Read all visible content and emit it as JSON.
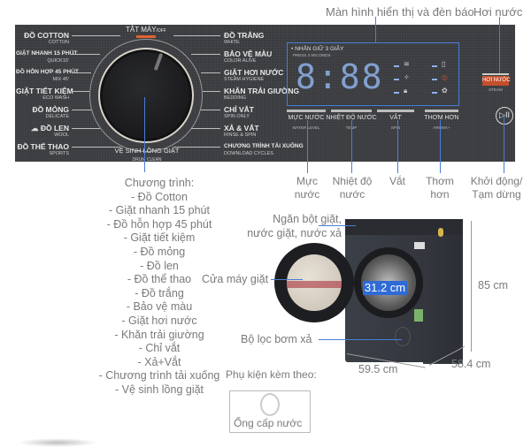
{
  "top_callouts": {
    "display": "Màn hình hiển thị và đèn báo",
    "steam": "Hơi nước"
  },
  "panel": {
    "off_label": "TẮT MÁY",
    "off_sub": "/OFF",
    "drum_clean": "VỆ SINH LỒNG GIẶT",
    "drum_clean_sub": "DRUM CLEAN",
    "left_programs": [
      {
        "label": "ĐỒ COTTON",
        "sub": "COTTON"
      },
      {
        "label": "GIẶT NHANH 15 PHÚT",
        "sub": "QUICK15'"
      },
      {
        "label": "ĐỒ HỖN HỢP 45 PHÚT",
        "sub": "MIX 45'"
      },
      {
        "label": "GIẶT TIẾT KIỆM",
        "sub": "ECO WASH"
      },
      {
        "label": "ĐỒ MỎNG",
        "sub": "DELICATE"
      },
      {
        "label": "ĐỒ LEN",
        "sub": "WOOL"
      },
      {
        "label": "ĐỒ THỂ THAO",
        "sub": "SPORTS"
      }
    ],
    "right_programs": [
      {
        "label": "ĐỒ TRẮNG",
        "sub": "WHITE"
      },
      {
        "label": "BẢO VỆ MÀU",
        "sub": "COLOR ALIVE"
      },
      {
        "label": "GIẶT HƠI NƯỚC",
        "sub": "STEAM HYGIENE"
      },
      {
        "label": "KHĂN TRẢI GIƯỜNG",
        "sub": "BEDDING"
      },
      {
        "label": "CHỈ VẮT",
        "sub": "SPIN ONLY"
      },
      {
        "label": "XẢ & VẮT",
        "sub": "RINSE & SPIN"
      },
      {
        "label": "CHƯƠNG TRÌNH TẢI XUỐNG",
        "sub": "DOWNLOAD CYCLES"
      }
    ],
    "display": {
      "hold_label": "• NHẤN GIỮ 3 GIÂY",
      "hold_sub": "PRESS 3 SECONDS",
      "digits": "8:88"
    },
    "buttons": [
      {
        "label": "MỰC NƯỚC",
        "sub": "WATER LEVEL"
      },
      {
        "label": "NHIỆT ĐỘ NƯỚC",
        "sub": "TEMP"
      },
      {
        "label": "VẮT",
        "sub": "SPIN"
      },
      {
        "label": "THƠM HƠN",
        "sub": "AROMA+"
      }
    ],
    "steam_button": "HƠI NƯỚC",
    "steam_sub": "STEAM",
    "play_pause_icon": "▷II"
  },
  "bottom_callouts": {
    "water_level": [
      "Mực",
      "nước"
    ],
    "temp": [
      "Nhiệt độ",
      "nước"
    ],
    "spin": [
      "Vắt"
    ],
    "aroma": [
      "Thơm",
      "hơn"
    ],
    "start_pause": [
      "Khởi động/",
      "Tạm dừng"
    ]
  },
  "program_list": {
    "title": "Chương trình:",
    "items": [
      "- Đồ Cotton",
      "- Giặt nhanh 15 phút",
      "- Đồ hỗn hợp 45 phút",
      "- Giặt tiết kiệm",
      "- Đồ mỏng",
      "- Đồ len",
      "- Đồ thể thao",
      "- Đồ trắng",
      "- Bảo vệ màu",
      "- Giặt hơi nước",
      "- Khăn trải giường",
      "- Chỉ vắt",
      "- Xả+Vắt",
      "- Chương trình tải xuống",
      "- Vệ sinh lồng giặt"
    ]
  },
  "machine": {
    "detergent_label": [
      "Ngăn bột giặt,",
      "nước giặt, nước xả"
    ],
    "door_label": "Cửa máy giặt",
    "filter_label": "Bộ lọc bơm xả",
    "door_diameter": "31.2 cm",
    "height": "85 cm",
    "width": "59.5 cm",
    "depth": "58.4 cm"
  },
  "accessories": {
    "title": "Phụ kiện kèm theo:",
    "item": "Ống cấp nước"
  }
}
